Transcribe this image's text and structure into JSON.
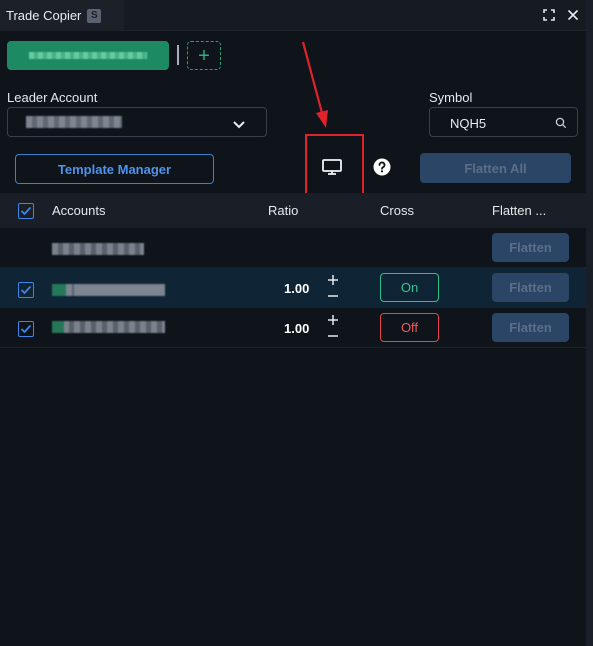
{
  "window": {
    "title": "Trade Copier",
    "badge": "S"
  },
  "chips": {
    "account_chip_label": "APEX-210099-07 · NQH5",
    "add_label": "+"
  },
  "leader": {
    "label": "Leader Account",
    "value": "REDACTED"
  },
  "symbol": {
    "label": "Symbol",
    "value": "NQH5"
  },
  "actions": {
    "template_manager": "Template Manager",
    "flatten_all": "Flatten All"
  },
  "table": {
    "headers": {
      "accounts": "Accounts",
      "ratio": "Ratio",
      "cross": "Cross",
      "flatten": "Flatten ..."
    },
    "rows": [
      {
        "account": "REDACTED",
        "ratio": "",
        "cross": "",
        "flatten": "Flatten"
      },
      {
        "account": "REDACTED",
        "ratio": "1.00",
        "cross": "On",
        "flatten": "Flatten"
      },
      {
        "account": "REDACTED",
        "ratio": "1.00",
        "cross": "Off",
        "flatten": "Flatten"
      }
    ]
  },
  "colors": {
    "accent_green": "#1d8a64",
    "accent_blue": "#3f7fd0",
    "highlight_red": "#e0232a",
    "on_green": "#34c58f",
    "off_red": "#ef5a5f"
  },
  "icons": [
    "expand-icon",
    "close-icon",
    "chevron-down-icon",
    "search-icon",
    "monitor-icon",
    "help-icon",
    "checkbox-icon",
    "plus-icon",
    "minus-icon"
  ]
}
